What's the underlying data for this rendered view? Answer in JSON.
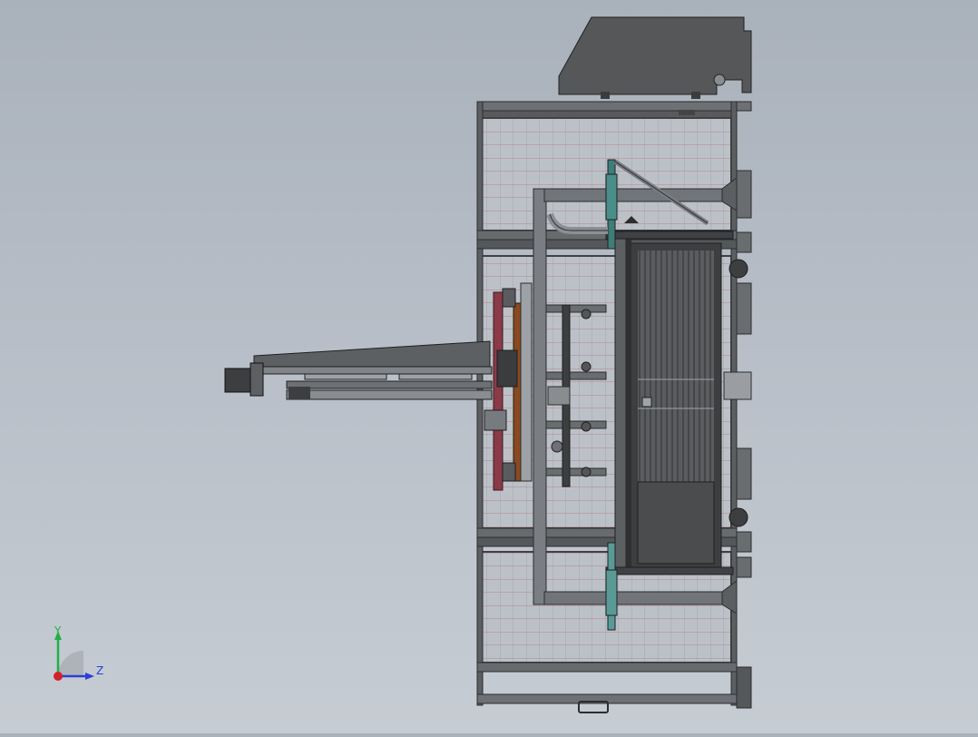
{
  "viewport": {
    "background_top": "#a9b1bb",
    "background_bottom": "#c6ccd3",
    "model": "machine-assembly-top-view"
  },
  "triad": {
    "y_label": "Y",
    "z_label": "Z",
    "y_color": "#1fb04a",
    "z_color": "#2c3fd6",
    "x_color": "#d4202a"
  },
  "colors": {
    "frame": "#4d4f52",
    "frame_light": "#7c7f83",
    "mesh_bg": "#b9bec4",
    "mesh_line_red": "#b3545c",
    "mesh_line_grey": "#8a9097",
    "panel_dark": "#3c3e40",
    "wood": "#8a4a1f",
    "maroon": "#8b3a47",
    "teal": "#5a9a96"
  }
}
